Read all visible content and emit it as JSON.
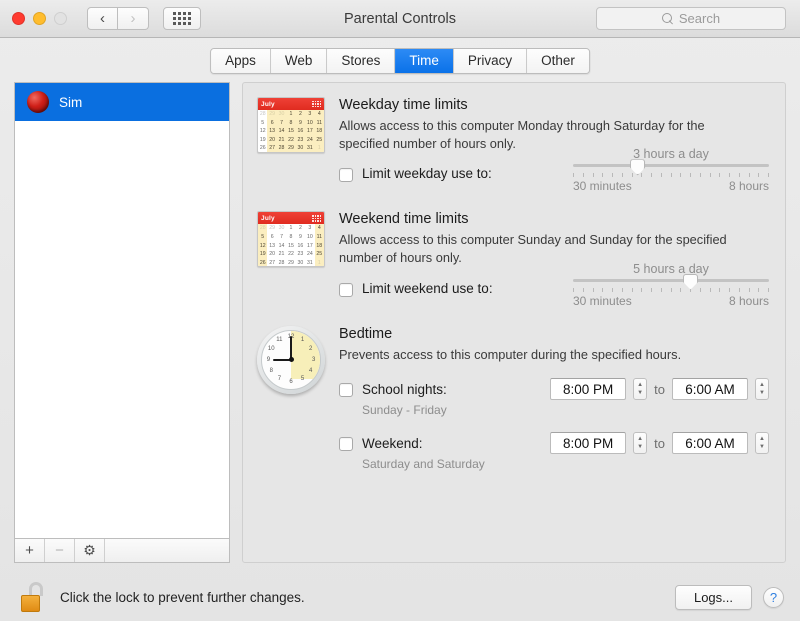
{
  "window": {
    "title": "Parental Controls",
    "traffic_lights": [
      "close",
      "minimize",
      "zoom"
    ],
    "nav": {
      "back": "‹",
      "forward": "›",
      "show_all": "grid-icon"
    },
    "search": {
      "placeholder": "Search",
      "value": ""
    }
  },
  "tabs": [
    {
      "label": "Apps",
      "active": false
    },
    {
      "label": "Web",
      "active": false
    },
    {
      "label": "Stores",
      "active": false
    },
    {
      "label": "Time",
      "active": true
    },
    {
      "label": "Privacy",
      "active": false
    },
    {
      "label": "Other",
      "active": false
    }
  ],
  "sidebar": {
    "users": [
      {
        "name": "Sim",
        "selected": true
      }
    ],
    "toolbar": {
      "add": "+",
      "remove": "−",
      "settings": "⚙"
    }
  },
  "calendar_icon": {
    "month": "July",
    "weeks": [
      [
        "28",
        "29",
        "30",
        "1",
        "2",
        "3",
        "4"
      ],
      [
        "5",
        "6",
        "7",
        "8",
        "9",
        "10",
        "11"
      ],
      [
        "12",
        "13",
        "14",
        "15",
        "16",
        "17",
        "18"
      ],
      [
        "19",
        "20",
        "21",
        "22",
        "23",
        "24",
        "25"
      ],
      [
        "26",
        "27",
        "28",
        "29",
        "30",
        "31",
        "1"
      ]
    ],
    "muted": [
      "28",
      "29",
      "30"
    ]
  },
  "sections": {
    "weekday": {
      "title": "Weekday time limits",
      "description": "Allows access to this computer Monday through Saturday for the specified number of hours only.",
      "checkbox_label": "Limit weekday use to:",
      "checked": false,
      "slider": {
        "value_label": "3 hours a day",
        "min_label": "30 minutes",
        "max_label": "8 hours",
        "position_percent": 33
      }
    },
    "weekend": {
      "title": "Weekend time limits",
      "description": "Allows access to this computer Sunday and Sunday for the specified number of hours only.",
      "checkbox_label": "Limit weekend use to:",
      "checked": false,
      "slider": {
        "value_label": "5 hours a day",
        "min_label": "30 minutes",
        "max_label": "8 hours",
        "position_percent": 60
      }
    },
    "bedtime": {
      "title": "Bedtime",
      "description": "Prevents access to this computer during the specified hours.",
      "rows": [
        {
          "checkbox_label": "School nights:",
          "sublabel": "Sunday - Friday",
          "checked": false,
          "from": "8:00 PM",
          "to_label": "to",
          "to": "6:00 AM"
        },
        {
          "checkbox_label": "Weekend:",
          "sublabel": "Saturday and Saturday",
          "checked": false,
          "from": "8:00 PM",
          "to_label": "to",
          "to": "6:00 AM"
        }
      ]
    }
  },
  "footer": {
    "lock_text": "Click the lock to prevent further changes.",
    "lock_state": "unlocked",
    "logs_button": "Logs...",
    "help_button": "?"
  },
  "colors": {
    "accent_blue": "#0a6fe0",
    "calendar_red": "#e02b20",
    "calendar_highlight": "#fbeec0",
    "lock_gold": "#e08b14",
    "help_blue": "#2f7fe0"
  }
}
